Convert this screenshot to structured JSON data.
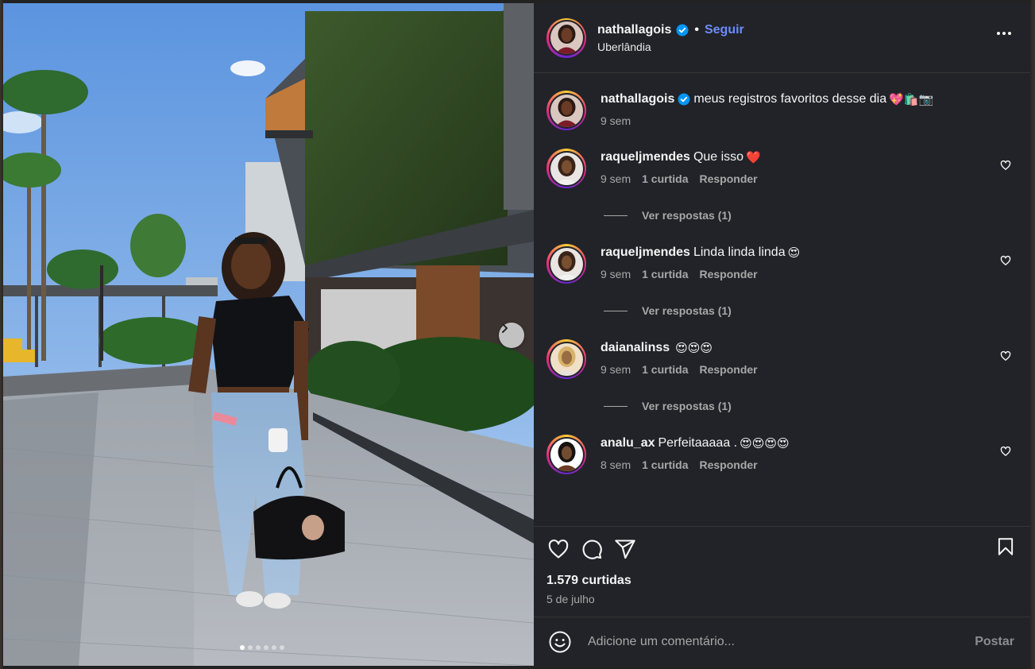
{
  "post": {
    "author": "nathallagois",
    "location": "Uberlândia",
    "follow_label": "Seguir",
    "separator": "•",
    "caption": {
      "username": "nathallagois",
      "text": "meus registros favoritos desse dia",
      "emojis": "💖🛍️📷",
      "time": "9 sem"
    },
    "carousel": {
      "count": 6,
      "active_index": 0
    },
    "likes": "1.579 curtidas",
    "date": "5 de julho"
  },
  "comments": [
    {
      "username": "raqueljmendes",
      "text": "Que isso",
      "emojis": "❤️",
      "time": "9 sem",
      "likes": "1 curtida",
      "reply_label": "Responder",
      "view_replies": "Ver respostas (1)"
    },
    {
      "username": "raqueljmendes",
      "text": "Linda linda linda",
      "emojis": "😍",
      "time": "9 sem",
      "likes": "1 curtida",
      "reply_label": "Responder",
      "view_replies": "Ver respostas (1)"
    },
    {
      "username": "daianalinss",
      "text": "",
      "emojis": "😍😍😍",
      "time": "9 sem",
      "likes": "1 curtida",
      "reply_label": "Responder",
      "view_replies": "Ver respostas (1)"
    },
    {
      "username": "analu_ax",
      "text": "Perfeitaaaaa .",
      "emojis": "😍😍😍😍",
      "time": "8 sem",
      "likes": "1 curtida",
      "reply_label": "Responder",
      "view_replies": ""
    }
  ],
  "composer": {
    "placeholder": "Adicione um comentário...",
    "post_label": "Postar"
  },
  "colors": {
    "panel_bg": "#212328",
    "link_blue": "#6c8cff",
    "verified_blue": "#0095f6",
    "muted_text": "#a8a8a8"
  },
  "icons": [
    "verified-badge-icon",
    "more-options-icon",
    "heart-icon",
    "comment-icon",
    "share-icon",
    "bookmark-icon",
    "emoji-icon",
    "chevron-right-icon"
  ]
}
